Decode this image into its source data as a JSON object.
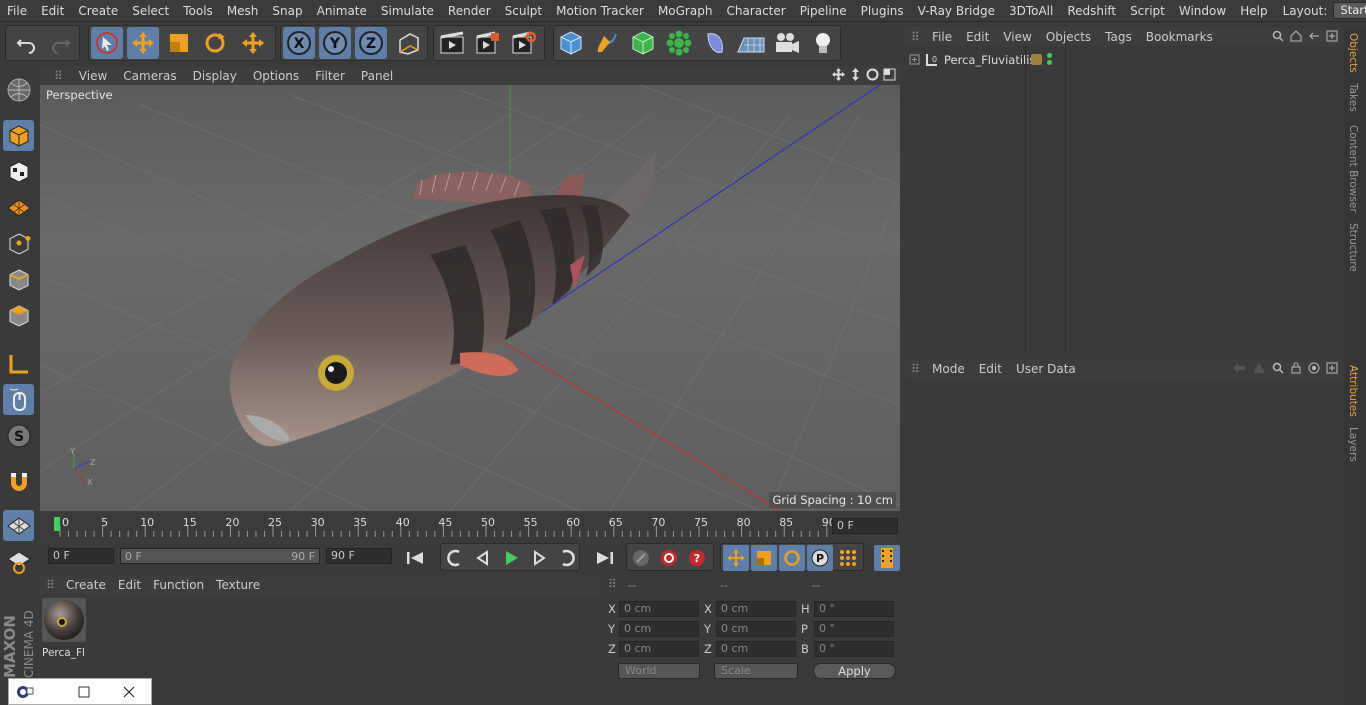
{
  "menubar": {
    "items": [
      "File",
      "Edit",
      "Create",
      "Select",
      "Tools",
      "Mesh",
      "Snap",
      "Animate",
      "Simulate",
      "Render",
      "Sculpt",
      "Motion Tracker",
      "MoGraph",
      "Character",
      "Pipeline",
      "Plugins",
      "V-Ray Bridge",
      "3DToAll",
      "Redshift",
      "Script",
      "Window",
      "Help"
    ],
    "layout_label": "Layout:",
    "layout_value": "Startup"
  },
  "viewport": {
    "menu": [
      "View",
      "Cameras",
      "Display",
      "Options",
      "Filter",
      "Panel"
    ],
    "camera": "Perspective",
    "grid_spacing": "Grid Spacing : 10 cm"
  },
  "timeline": {
    "ticks": [
      "0",
      "5",
      "10",
      "15",
      "20",
      "25",
      "30",
      "35",
      "40",
      "45",
      "50",
      "55",
      "60",
      "65",
      "70",
      "75",
      "80",
      "85",
      "90"
    ],
    "current_frame": "0 F"
  },
  "transport": {
    "start_frame": "0 F",
    "range_start": "0 F",
    "range_end": "90 F",
    "end_frame": "90 F"
  },
  "material_manager": {
    "menu": [
      "Create",
      "Edit",
      "Function",
      "Texture"
    ],
    "material_name": "Perca_Fl"
  },
  "coordinates": {
    "headers": [
      "--",
      "--",
      "--"
    ],
    "pos": {
      "x": "0 cm",
      "y": "0 cm",
      "z": "0 cm"
    },
    "size": {
      "x": "0 cm",
      "y": "0 cm",
      "z": "0 cm"
    },
    "rot": {
      "h": "0 °",
      "p": "0 °",
      "b": "0 °"
    },
    "labels": {
      "x": "X",
      "y": "Y",
      "z": "Z",
      "h": "H",
      "p": "P",
      "b": "B"
    },
    "mode": "World",
    "scale": "Scale",
    "apply": "Apply"
  },
  "object_manager": {
    "menu": [
      "File",
      "Edit",
      "View",
      "Objects",
      "Tags",
      "Bookmarks"
    ],
    "object_name": "Perca_Fluviatilis"
  },
  "attribute_manager": {
    "menu": [
      "Mode",
      "Edit",
      "User Data"
    ]
  },
  "side_tabs": [
    "Objects",
    "Takes",
    "Content Browser",
    "Structure",
    "Attributes",
    "Layers"
  ],
  "branding": {
    "line1": "MAXON",
    "line2": "CINEMA 4D"
  },
  "colors": {
    "accent": "#5d7fa8",
    "active_tab": "#e8a043",
    "bg": "#3a3a3a"
  }
}
